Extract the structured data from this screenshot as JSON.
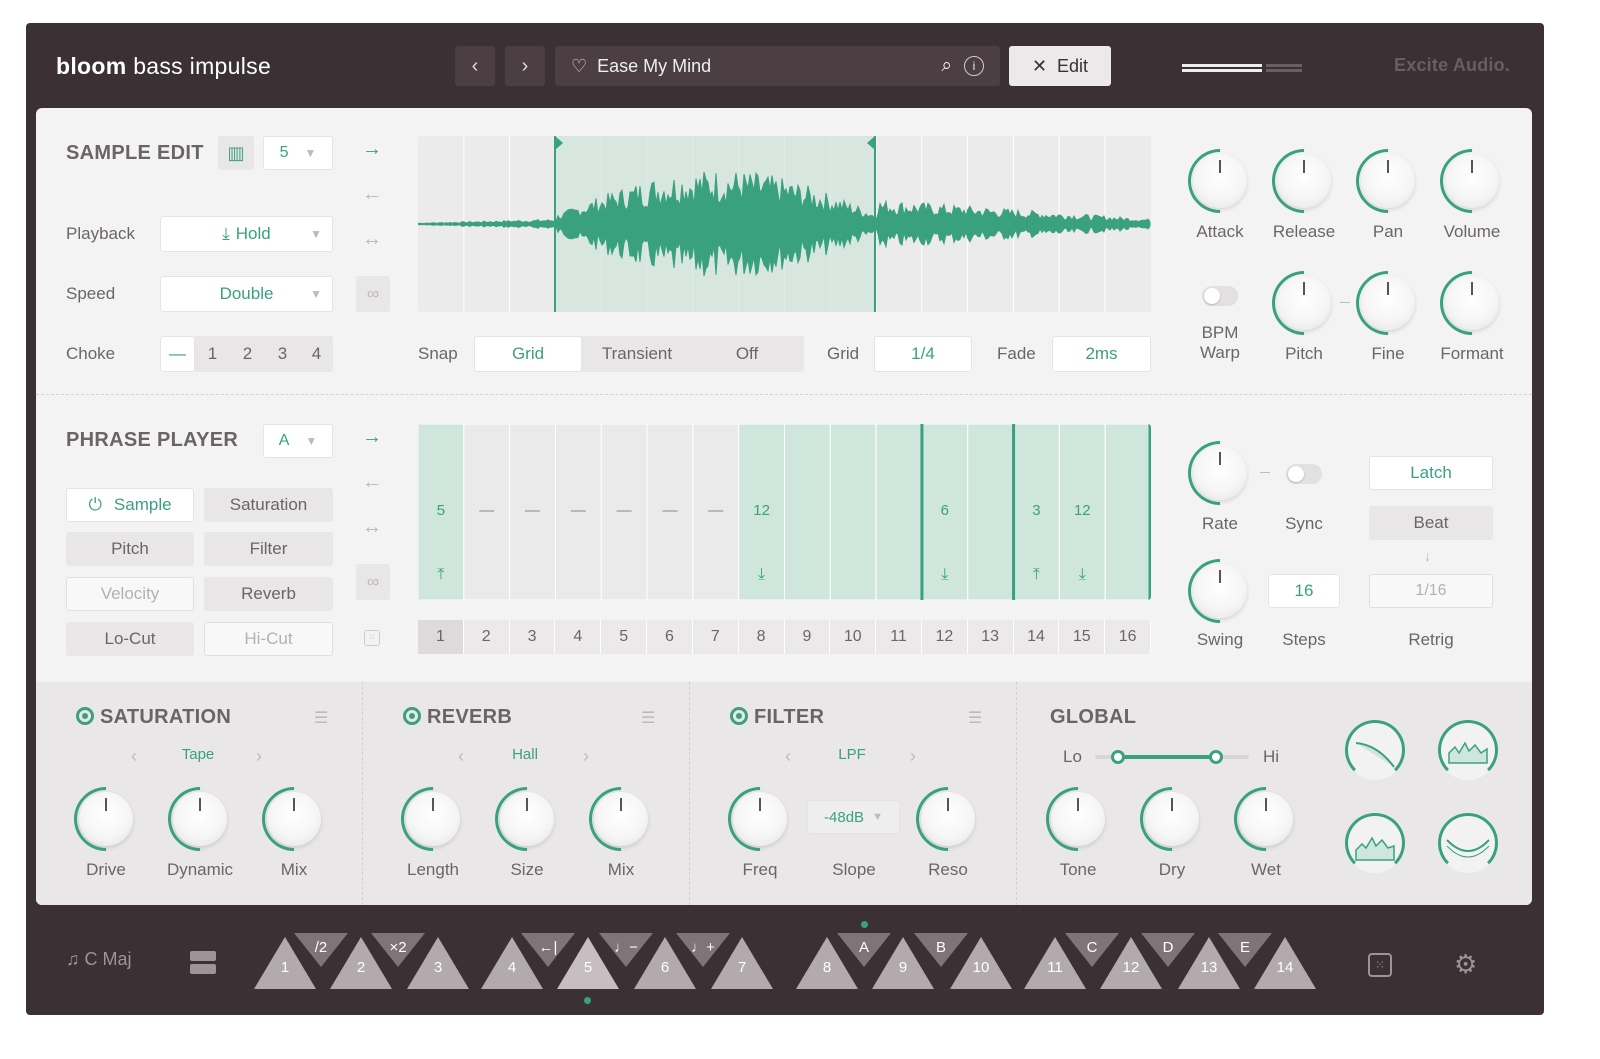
{
  "header": {
    "brand_bold": "bloom",
    "brand_rest": "bass impulse",
    "preset_name": "Ease My Mind",
    "edit_label": "Edit",
    "maker": "Excite Audio."
  },
  "sample_edit": {
    "title": "SAMPLE EDIT",
    "sample_number": "5",
    "playback_label": "Playback",
    "playback_value": "Hold",
    "speed_label": "Speed",
    "speed_value": "Double",
    "choke_label": "Choke",
    "choke_options": [
      "—",
      "1",
      "2",
      "3",
      "4"
    ],
    "snap_label": "Snap",
    "snap_options": [
      "Grid",
      "Transient",
      "Off"
    ],
    "grid_label": "Grid",
    "grid_value": "1/4",
    "fade_label": "Fade",
    "fade_value": "2ms"
  },
  "sample_knobs": {
    "attack": "Attack",
    "release": "Release",
    "pan": "Pan",
    "volume": "Volume",
    "bpm_warp": "BPM\nWarp",
    "pitch": "Pitch",
    "fine": "Fine",
    "formant": "Formant"
  },
  "phrase_player": {
    "title": "PHRASE PLAYER",
    "phrase": "A",
    "tabs": [
      "Sample",
      "Saturation",
      "Pitch",
      "Filter",
      "Velocity",
      "Reverb",
      "Lo-Cut",
      "Hi-Cut"
    ],
    "steps": [
      "5",
      "—",
      "—",
      "—",
      "—",
      "—",
      "—",
      "12",
      "",
      "",
      "",
      "6",
      "",
      "3",
      "12",
      ""
    ],
    "step_numbers": [
      "1",
      "2",
      "3",
      "4",
      "5",
      "6",
      "7",
      "8",
      "9",
      "10",
      "11",
      "12",
      "13",
      "14",
      "15",
      "16"
    ]
  },
  "phrase_knobs": {
    "rate": "Rate",
    "sync": "Sync",
    "latch": "Latch",
    "beat": "Beat",
    "swing": "Swing",
    "steps_value": "16",
    "steps": "Steps",
    "retrig_value": "1/16",
    "retrig": "Retrig"
  },
  "saturation": {
    "title": "SATURATION",
    "type": "Tape",
    "knobs": [
      "Drive",
      "Dynamic",
      "Mix"
    ]
  },
  "reverb": {
    "title": "REVERB",
    "type": "Hall",
    "knobs": [
      "Length",
      "Size",
      "Mix"
    ]
  },
  "filter": {
    "title": "FILTER",
    "type": "LPF",
    "slope_value": "-48dB",
    "knobs": [
      "Freq",
      "Slope",
      "Reso"
    ]
  },
  "global": {
    "title": "GLOBAL",
    "lo": "Lo",
    "hi": "Hi",
    "knobs": [
      "Tone",
      "Dry",
      "Wet"
    ]
  },
  "footer": {
    "key": "C Maj",
    "pads": [
      "1",
      "2",
      "3",
      "4",
      "5",
      "6",
      "7",
      "8",
      "9",
      "10",
      "11",
      "12",
      "13",
      "14"
    ],
    "top_pads": [
      "/2",
      "×2",
      "←|",
      "♩−",
      "♩+",
      "A",
      "B",
      "C",
      "D",
      "E"
    ]
  },
  "colors": {
    "accent": "#3aa17f",
    "dark": "#3b3034"
  }
}
